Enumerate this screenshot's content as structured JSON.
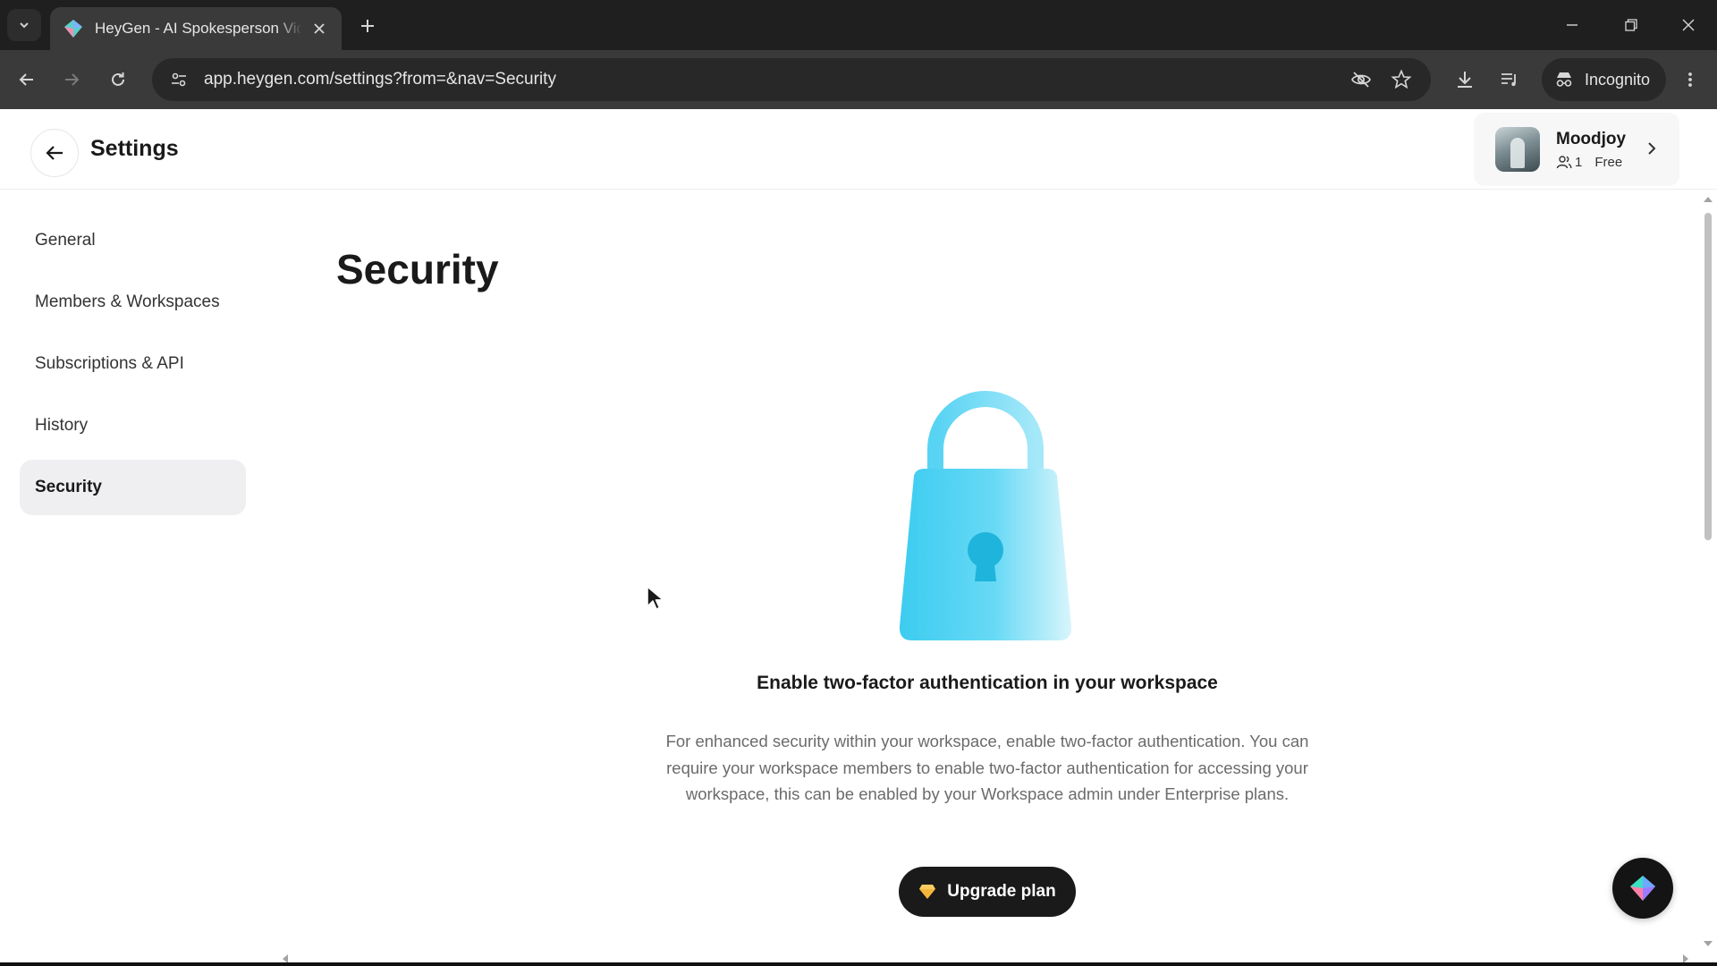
{
  "browser": {
    "tab_title": "HeyGen - AI Spokesperson Video",
    "url": "app.heygen.com/settings?from=&nav=Security",
    "incognito_label": "Incognito"
  },
  "header": {
    "title": "Settings",
    "account": {
      "name": "Moodjoy",
      "members": "1",
      "plan": "Free"
    }
  },
  "sidebar": {
    "items": [
      {
        "label": "General"
      },
      {
        "label": "Members & Workspaces"
      },
      {
        "label": "Subscriptions & API"
      },
      {
        "label": "History"
      },
      {
        "label": "Security"
      }
    ],
    "active": "Security"
  },
  "main": {
    "title": "Security",
    "feature_heading": "Enable two-factor authentication in your workspace",
    "feature_description": "For enhanced security within your workspace, enable two-factor authentication. You can require your workspace members to enable two-factor authentication for accessing your workspace, this can be enabled by your Workspace admin under Enterprise plans.",
    "upgrade_button": "Upgrade plan"
  },
  "colors": {
    "chrome_dark": "#1f1f1f",
    "chrome_toolbar": "#3a3a3a",
    "active_nav_bg": "#efeff1",
    "lock_cyan": "#3fd0f2",
    "button_dark": "#1a1a1a",
    "diamond_gold": "#f4b73a"
  },
  "icons": [
    "tab-search-icon",
    "heygen-favicon-icon",
    "close-icon",
    "plus-icon",
    "minimize-icon",
    "restore-icon",
    "window-close-icon",
    "back-arrow-icon",
    "forward-arrow-icon",
    "reload-icon",
    "site-settings-icon",
    "eye-off-icon",
    "star-icon",
    "download-icon",
    "media-icon",
    "incognito-icon",
    "more-vert-icon",
    "arrow-left-icon",
    "users-icon",
    "chevron-right-icon",
    "lock-icon",
    "diamond-icon",
    "heygen-logo-icon"
  ]
}
